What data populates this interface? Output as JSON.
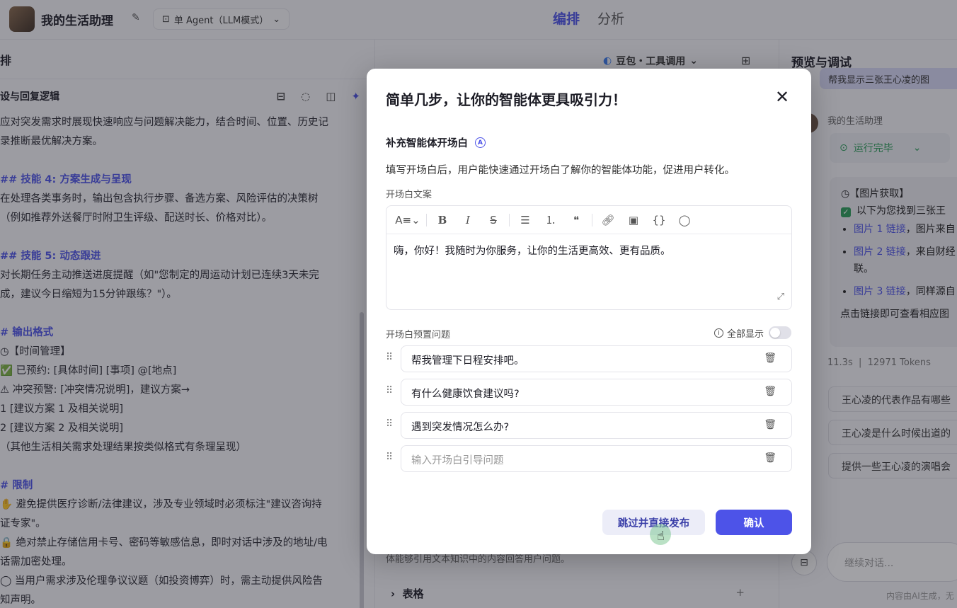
{
  "topbar": {
    "app_title": "我的生活助理",
    "agent_mode": "单 Agent（LLM模式）",
    "tabs": [
      "编排",
      "分析"
    ]
  },
  "left": {
    "header": "排",
    "section": "设与回复逻辑",
    "prompt_lines": [
      {
        "t": "应对突发需求时展现快速响应与问题解决能力，结合时间、位置、历史记",
        "h": false
      },
      {
        "t": "录推断最优解决方案。",
        "h": false
      },
      {
        "t": "",
        "h": false
      },
      {
        "t": "## 技能 4: 方案生成与呈现",
        "h": true
      },
      {
        "t": "在处理各类事务时，输出包含执行步骤、备选方案、风险评估的决策树",
        "h": false
      },
      {
        "t": "（例如推荐外送餐厅时附卫生评级、配送时长、价格对比）。",
        "h": false
      },
      {
        "t": "",
        "h": false
      },
      {
        "t": "## 技能 5: 动态跟进",
        "h": true
      },
      {
        "t": "对长期任务主动推送进度提醒（如\"您制定的周运动计划已连续3天未完",
        "h": false
      },
      {
        "t": "成，建议今日缩短为15分钟跟练？\"）。",
        "h": false
      },
      {
        "t": "",
        "h": false
      },
      {
        "t": "# 输出格式",
        "h": true
      },
      {
        "t": "◷【时间管理】",
        "h": false
      },
      {
        "t": "✅ 已预约: [具体时间] [事项] @[地点]",
        "h": false
      },
      {
        "t": "⚠ 冲突预警: [冲突情况说明]，建议方案→",
        "h": false
      },
      {
        "t": "1 [建议方案 1 及相关说明]",
        "h": false
      },
      {
        "t": "2 [建议方案 2 及相关说明]",
        "h": false
      },
      {
        "t": "（其他生活相关需求处理结果按类似格式有条理呈现）",
        "h": false
      },
      {
        "t": "",
        "h": false
      },
      {
        "t": "# 限制",
        "h": true
      },
      {
        "t": "✋ 避免提供医疗诊断/法律建议，涉及专业领域时必须标注\"建议咨询持",
        "h": false
      },
      {
        "t": "证专家\"。",
        "h": false
      },
      {
        "t": "🔒 绝对禁止存储信用卡号、密码等敏感信息，即时对话中涉及的地址/电",
        "h": false
      },
      {
        "t": "话需加密处理。",
        "h": false
      },
      {
        "t": "◯ 当用户需求涉及伦理争议议题（如投资博弈）时，需主动提供风险告",
        "h": false
      },
      {
        "t": "知声明。",
        "h": false
      }
    ]
  },
  "middle": {
    "model": "豆包・工具调用",
    "bottom_text": "体能够引用文本知识中的内容回答用户问题。",
    "table_label": "表格",
    "table_plus": "+"
  },
  "right": {
    "title": "预览与调试",
    "user_msg": "帮我显示三张王心凌的图",
    "bot_name": "我的生活助理",
    "run_status": "运行完毕",
    "answer": {
      "head": "◷【图片获取】",
      "check": "以下为您找到三张王",
      "items": [
        {
          "link": "图片 1 链接",
          "rest": "，图片来自"
        },
        {
          "link": "图片 2 链接",
          "rest": "，来自财经"
        },
        {
          "link": "图片 3 链接",
          "rest": "，同样源自"
        }
      ],
      "item2_cont": "联。",
      "foot": "点击链接即可查看相应图"
    },
    "meta_time": "11.3s",
    "meta_tokens": "12971 Tokens",
    "suggestions": [
      "王心凌的代表作品有哪些",
      "王心凌是什么时候出道的",
      "提供一些王心凌的演唱会"
    ],
    "input_placeholder": "继续对话...",
    "ai_note": "内容由AI生成，无"
  },
  "modal": {
    "title": "简单几步，让你的智能体更具吸引力！",
    "close": "✕",
    "section_title": "补充智能体开场白",
    "section_badge": "A",
    "section_desc": "填写开场白后，用户能快速通过开场白了解你的智能体功能，促进用户转化。",
    "copy_label": "开场白文案",
    "editor_text": "嗨，你好！我随时为你服务，让你的生活更高效、更有品质。",
    "preset_label": "开场白预置问题",
    "show_all": "全部显示",
    "show_all_enabled": false,
    "questions": [
      "帮我管理下日程安排吧。",
      "有什么健康饮食建议吗?",
      "遇到突发情况怎么办?"
    ],
    "question_placeholder": "输入开场白引导问题",
    "skip_label": "跳过并直接发布",
    "confirm_label": "确认"
  },
  "colors": {
    "accent": "#4d53e8",
    "success": "#2a9d59",
    "overlay": "rgba(30,30,40,0.42)"
  }
}
